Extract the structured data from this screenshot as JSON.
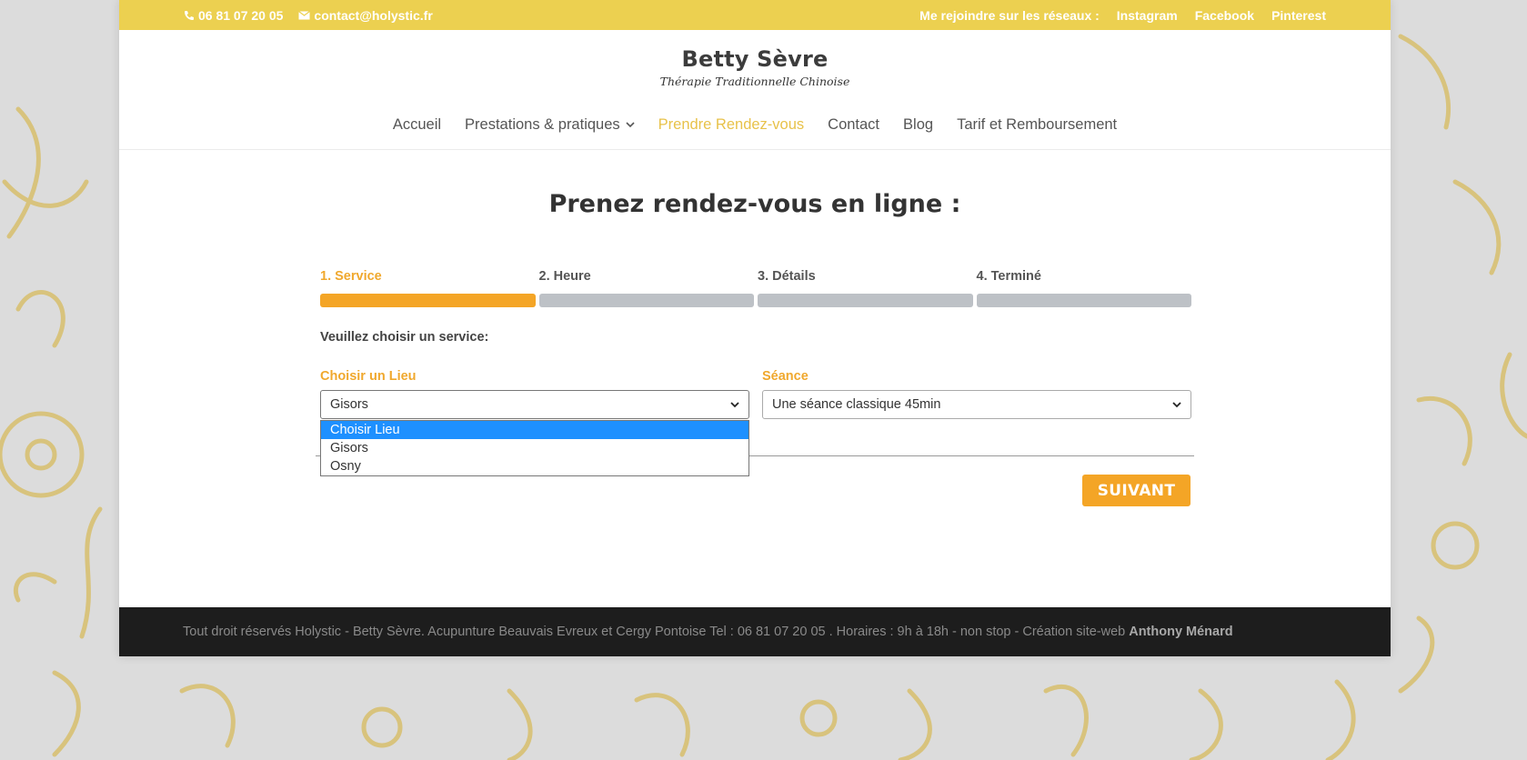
{
  "colors": {
    "accent": "#f4a526",
    "topbar": "#ecd050",
    "nav_active": "#e8c24a",
    "highlight": "#1e90ff"
  },
  "topbar": {
    "phone": "06 81 07 20 05",
    "email": "contact@holystic.fr",
    "social_prompt": "Me rejoindre sur les réseaux :",
    "links": [
      "Instagram",
      "Facebook",
      "Pinterest"
    ]
  },
  "logo": {
    "name": "Betty Sèvre",
    "tagline": "Thérapie Traditionnelle Chinoise"
  },
  "nav": {
    "items": [
      "Accueil",
      "Prestations & pratiques",
      "Prendre Rendez-vous",
      "Contact",
      "Blog",
      "Tarif et Remboursement"
    ],
    "active_index": 2
  },
  "page_title": "Prenez rendez-vous en ligne :",
  "wizard": {
    "steps": [
      "1. Service",
      "2. Heure",
      "3. Détails",
      "4. Terminé"
    ],
    "current_step": 1,
    "prompt": "Veuillez choisir un service:",
    "location": {
      "label": "Choisir un Lieu",
      "value": "Gisors",
      "options": [
        "Choisir Lieu",
        "Gisors",
        "Osny"
      ],
      "highlighted_option": "Choisir Lieu"
    },
    "session": {
      "label": "Séance",
      "value": "Une séance classique 45min"
    },
    "next_label": "SUIVANT"
  },
  "footer": {
    "text": "Tout droit réservés Holystic - Betty Sèvre. Acupunture Beauvais Evreux et Cergy Pontoise Tel : 06 81 07 20 05 . Horaires : 9h à 18h - non stop - Création site-web",
    "author": "Anthony Ménard"
  }
}
